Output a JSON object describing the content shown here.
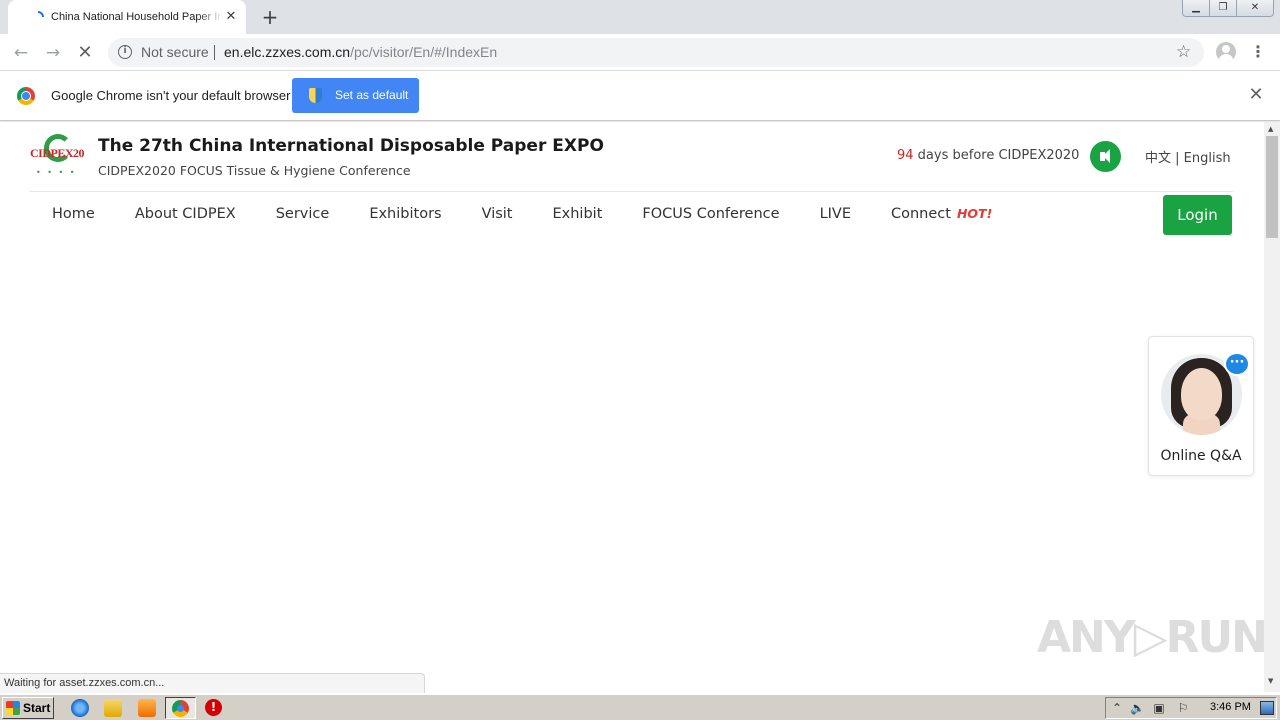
{
  "browser": {
    "tab_title": "China National Household Paper Industry",
    "new_tab_symbol": "+",
    "tab_close_symbol": "✕",
    "security_label": "Not secure",
    "url_host": "en.elc.zzxes.com.cn",
    "url_path": "/pc/visitor/En/#/IndexEn",
    "infobar_message": "Google Chrome isn't your default browser",
    "set_default_label": "Set as default",
    "infobar_close_symbol": "✕",
    "status_text": "Waiting for asset.zzxes.com.cn..."
  },
  "site": {
    "logo_text": "CIDPEX20",
    "title": "The 27th China International Disposable Paper EXPO",
    "subtitle": "CIDPEX2020 FOCUS Tissue & Hygiene Conference",
    "countdown_days": "94",
    "countdown_text": " days before CIDPEX2020",
    "lang_cn": "中文",
    "lang_sep": " | ",
    "lang_en": "English",
    "nav": [
      {
        "label": "Home"
      },
      {
        "label": "About CIDPEX"
      },
      {
        "label": "Service"
      },
      {
        "label": "Exhibitors"
      },
      {
        "label": "Visit"
      },
      {
        "label": "Exhibit"
      },
      {
        "label": "FOCUS Conference"
      },
      {
        "label": "LIVE"
      },
      {
        "label": "Connect"
      }
    ],
    "hot_badge": "HOT!",
    "login_label": "Login",
    "qa_label": "Online Q&A",
    "qa_bubble": "···"
  },
  "watermark": "ANY▷RUN",
  "taskbar": {
    "start_label": "Start",
    "clock": "3:46 PM"
  },
  "colors": {
    "brand_green": "#1aa342",
    "accent_red": "#c62828",
    "chrome_blue": "#4285f4"
  }
}
